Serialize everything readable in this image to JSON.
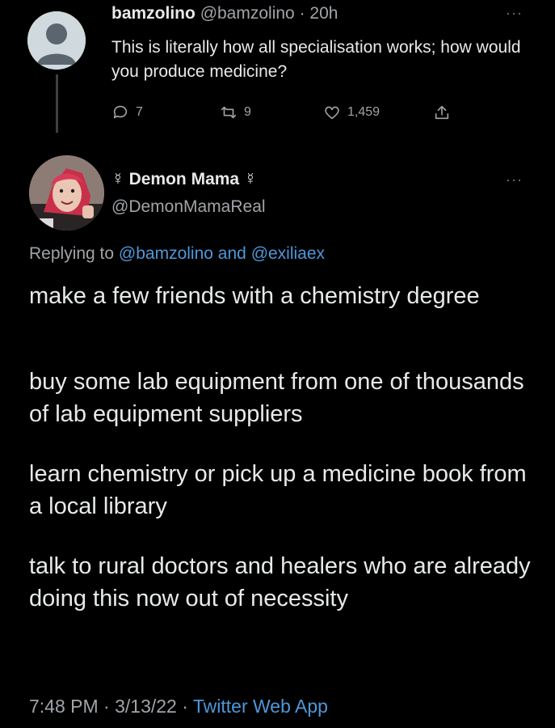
{
  "parent_tweet": {
    "display_name": "bamzolino",
    "handle": "@bamzolino",
    "separator": "·",
    "time": "20h",
    "text": "This is literally how all specialisation works; how would you produce medicine?",
    "more_label": "···",
    "actions": {
      "replies": "7",
      "retweets": "9",
      "likes": "1,459"
    },
    "avatar_icon": "default-profile-icon"
  },
  "reply_tweet": {
    "display_name": "☿ Demon Mama ☿",
    "handle": "@DemonMamaReal",
    "more_label": "···",
    "replying_prefix": "Replying to",
    "mention_1": "@bamzolino",
    "mention_joiner": "and",
    "mention_2": "@exiliaex",
    "paragraphs": [
      "make a few friends with a chemistry degree",
      "buy some lab equipment from one of thousands of lab equipment suppliers",
      "learn chemistry or pick up a medicine book from a local library",
      "talk to rural doctors and healers who are already doing this now out of necessity"
    ],
    "timestamp": "7:48 PM · 3/13/22 ·",
    "source": "Twitter Web App"
  },
  "colors": {
    "background": "#000000",
    "text": "#e7e9ea",
    "secondary": "#a0a4a8",
    "link": "#4f97d9"
  }
}
